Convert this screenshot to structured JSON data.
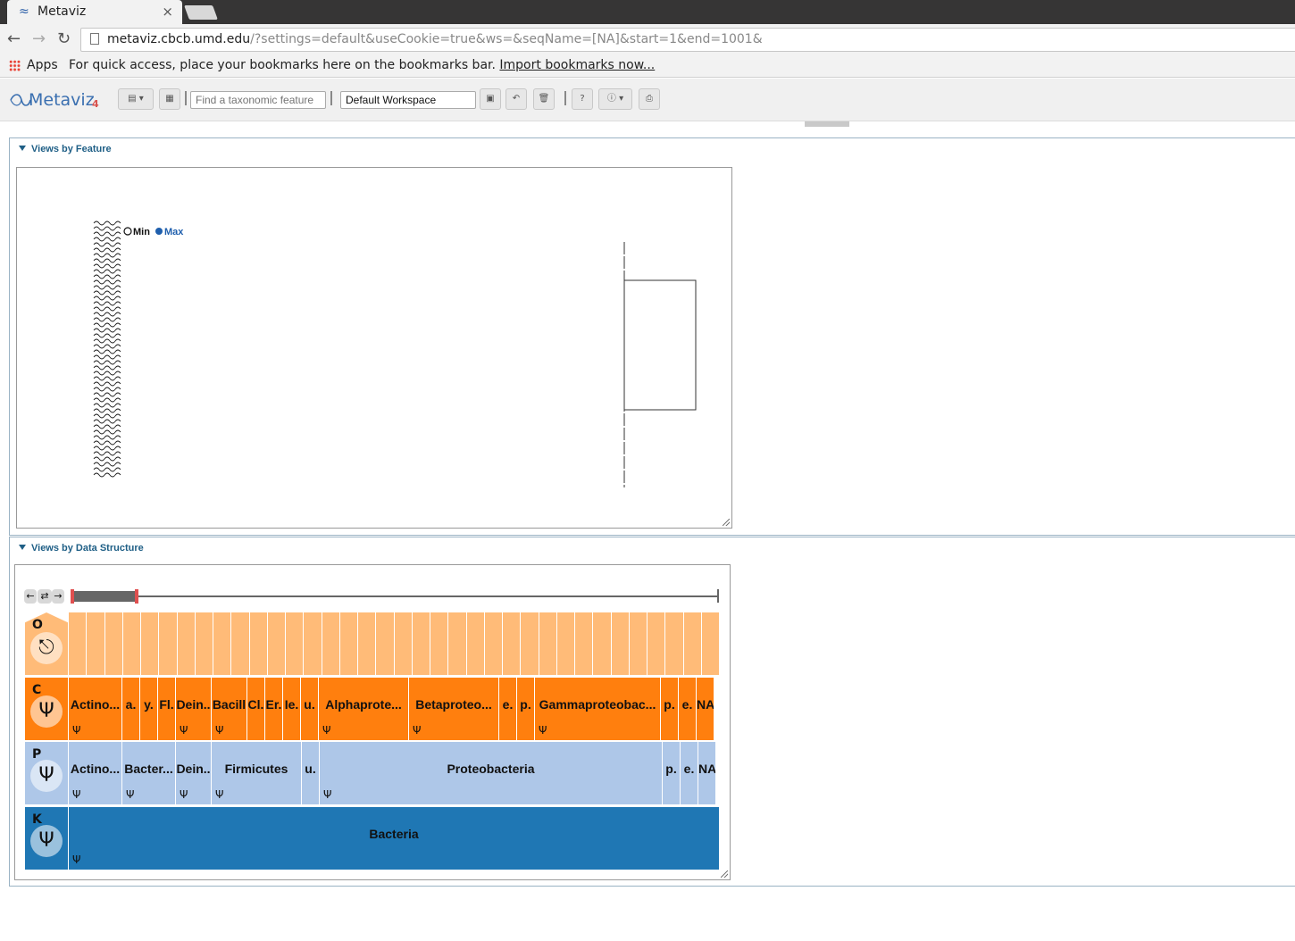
{
  "browser": {
    "tab_title": "Metaviz",
    "tab_close": "×",
    "url_host": "metaviz.cbcb.umd.edu",
    "url_rest": "/?settings=default&useCookie=true&ws=&seqName=[NA]&start=1&end=1001&",
    "apps_label": "Apps",
    "bookmarks_hint": "For quick access, place your bookmarks here on the bookmarks bar.",
    "bookmarks_link": "Import bookmarks now..."
  },
  "toolbar": {
    "logo_text": "Metaviz",
    "logo_sub": "4",
    "search_placeholder": "Find a taxonomic feature",
    "workspace_value": "Default Workspace"
  },
  "panels": {
    "feature_title": "Views by Feature",
    "structure_title": "Views by Data Structure"
  },
  "heatmap": {
    "legend_min": "Min",
    "legend_max": "Max",
    "colors": {
      "max": "#1f5fad"
    }
  },
  "icicle": {
    "levels": [
      {
        "letter": "O",
        "icon": "single-node-icon",
        "color": "#ffbb78"
      },
      {
        "letter": "C",
        "icon": "tree-icon",
        "color": "#ff7f0e"
      },
      {
        "letter": "P",
        "icon": "tree-icon",
        "color": "#aec7e8"
      },
      {
        "letter": "K",
        "icon": "tree-icon",
        "color": "#1f77b4"
      }
    ],
    "class_nodes": [
      {
        "label": "Actino...",
        "w": 60,
        "tree": true
      },
      {
        "label": "a.",
        "w": 20,
        "tree": false
      },
      {
        "label": "y.",
        "w": 20,
        "tree": false
      },
      {
        "label": "Fl.",
        "w": 20,
        "tree": false
      },
      {
        "label": "Dein..",
        "w": 40,
        "tree": true
      },
      {
        "label": "Bacill",
        "w": 40,
        "tree": true
      },
      {
        "label": "Cl.",
        "w": 20,
        "tree": false
      },
      {
        "label": "Er.",
        "w": 20,
        "tree": false
      },
      {
        "label": "Ie.",
        "w": 20,
        "tree": false
      },
      {
        "label": "u.",
        "w": 20,
        "tree": false
      },
      {
        "label": "Alphaprote...",
        "w": 101,
        "tree": true
      },
      {
        "label": "Betaproteo...",
        "w": 101,
        "tree": true
      },
      {
        "label": "e.",
        "w": 20,
        "tree": false
      },
      {
        "label": "p.",
        "w": 20,
        "tree": false
      },
      {
        "label": "Gammaproteobac...",
        "w": 141,
        "tree": true
      },
      {
        "label": "p.",
        "w": 20,
        "tree": false
      },
      {
        "label": "e.",
        "w": 20,
        "tree": false
      },
      {
        "label": "NA",
        "w": 20,
        "tree": false
      }
    ],
    "phylum_nodes": [
      {
        "label": "Actino...",
        "w": 60,
        "tree": true
      },
      {
        "label": "Bacter...",
        "w": 60,
        "tree": true
      },
      {
        "label": "Dein..",
        "w": 40,
        "tree": true
      },
      {
        "label": "Firmicutes",
        "w": 101,
        "tree": true
      },
      {
        "label": "u.",
        "w": 20,
        "tree": false
      },
      {
        "label": "Proteobacteria",
        "w": 384,
        "tree": true
      },
      {
        "label": "p.",
        "w": 20,
        "tree": false
      },
      {
        "label": "e.",
        "w": 20,
        "tree": false
      },
      {
        "label": "NA",
        "w": 20,
        "tree": false
      }
    ],
    "kingdom_nodes": [
      {
        "label": "Bacteria",
        "w": 729,
        "tree": true
      }
    ],
    "order_leaf_count": 36
  }
}
